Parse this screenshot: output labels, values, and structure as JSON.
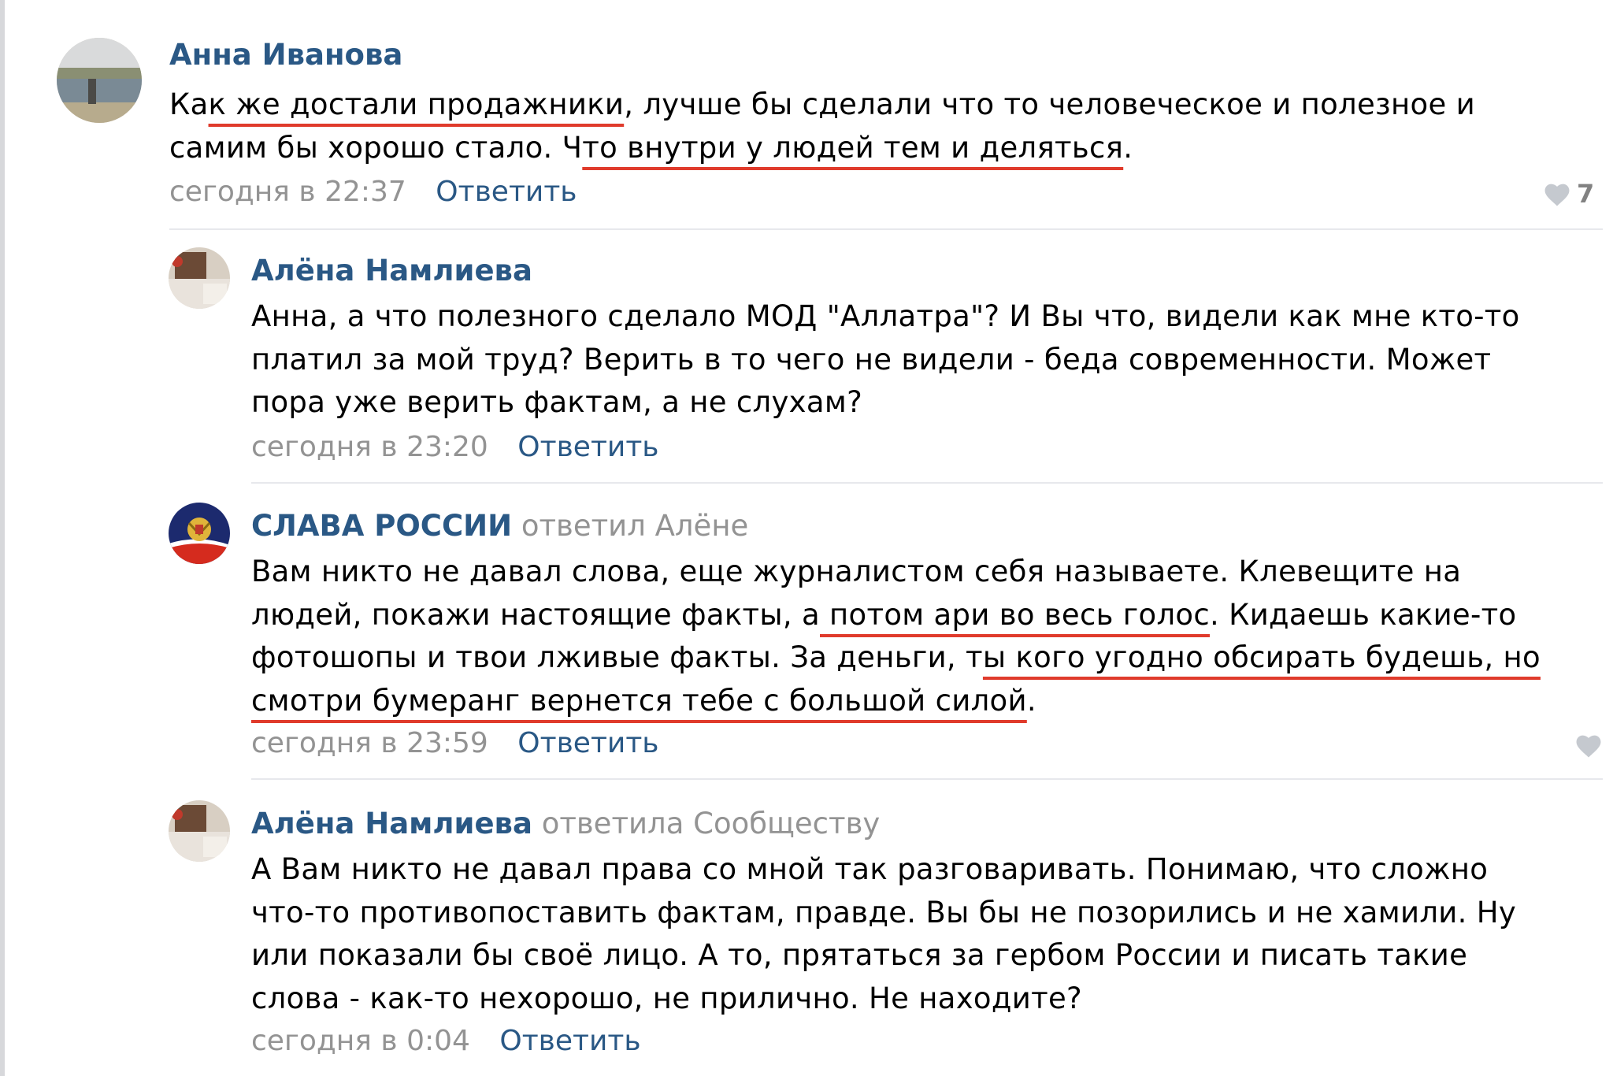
{
  "comments": [
    {
      "author": "Анна Иванова",
      "replied_to": "",
      "lines": [
        [
          {
            "t": "Ка",
            "u": false
          },
          {
            "t": "к же достали продажники",
            "u": true
          },
          {
            "t": ", лучше бы сделали что то человеческое и полезное и",
            "u": false
          }
        ],
        [
          {
            "t": "самим бы хорошо стало. Ч",
            "u": false
          },
          {
            "t": "то внутри у людей тем и деляться",
            "u": true
          },
          {
            "t": ".",
            "u": false
          }
        ]
      ],
      "date": "сегодня в 22:37",
      "reply": "Ответить",
      "likes": "7"
    },
    {
      "author": "Алёна Намлиева",
      "replied_to": "",
      "lines": [
        [
          {
            "t": "Анна, а что полезного сделало МОД \"Аллатра\"? И Вы что, видели как мне кто-то",
            "u": false
          }
        ],
        [
          {
            "t": "платил за мой труд? Верить в то чего не видели - беда современности. Может",
            "u": false
          }
        ],
        [
          {
            "t": "пора уже верить фактам, а не слухам?",
            "u": false
          }
        ]
      ],
      "date": "сегодня в 23:20",
      "reply": "Ответить",
      "likes": ""
    },
    {
      "author": "СЛАВА РОССИИ",
      "replied_to": "ответил Алёне",
      "lines": [
        [
          {
            "t": "Вам никто не давал слова, еще журналистом себя называете. Клевещите на",
            "u": false
          }
        ],
        [
          {
            "t": "людей, покажи настоящие факты, а",
            "u": false
          },
          {
            "t": " потом ари во весь голос",
            "u": true
          },
          {
            "t": ". Кидаешь какие-то",
            "u": false
          }
        ],
        [
          {
            "t": "фотошопы и твои лживые факты. За деньги, т",
            "u": false
          },
          {
            "t": "ы кого угодно обсирать будешь, но",
            "u": true
          }
        ],
        [
          {
            "t": "смотри бумеранг вернется тебе с большой силой",
            "u": true
          },
          {
            "t": ".",
            "u": false
          }
        ]
      ],
      "date": "сегодня в 23:59",
      "reply": "Ответить",
      "likes": ""
    },
    {
      "author": "Алёна Намлиева",
      "replied_to": "ответила Сообществу",
      "lines": [
        [
          {
            "t": "А Вам никто не давал права со мной так разговаривать. Понимаю, что сложно",
            "u": false
          }
        ],
        [
          {
            "t": "что-то противопоставить фактам, правде. Вы бы не позорились и не хамили. Ну",
            "u": false
          }
        ],
        [
          {
            "t": "или показали бы своё лицо. А то, прятаться за гербом России и писать такие",
            "u": false
          }
        ],
        [
          {
            "t": "слова - как-то нехорошо, не прилично. Не находите?",
            "u": false
          }
        ]
      ],
      "date": "сегодня в 0:04",
      "reply": "Ответить",
      "likes": ""
    }
  ],
  "icons": {
    "like": "heart-icon"
  },
  "colors": {
    "author": "#2a5885",
    "meta": "#939393",
    "underline": "#e03b2c",
    "divider": "#e7e8ec"
  }
}
